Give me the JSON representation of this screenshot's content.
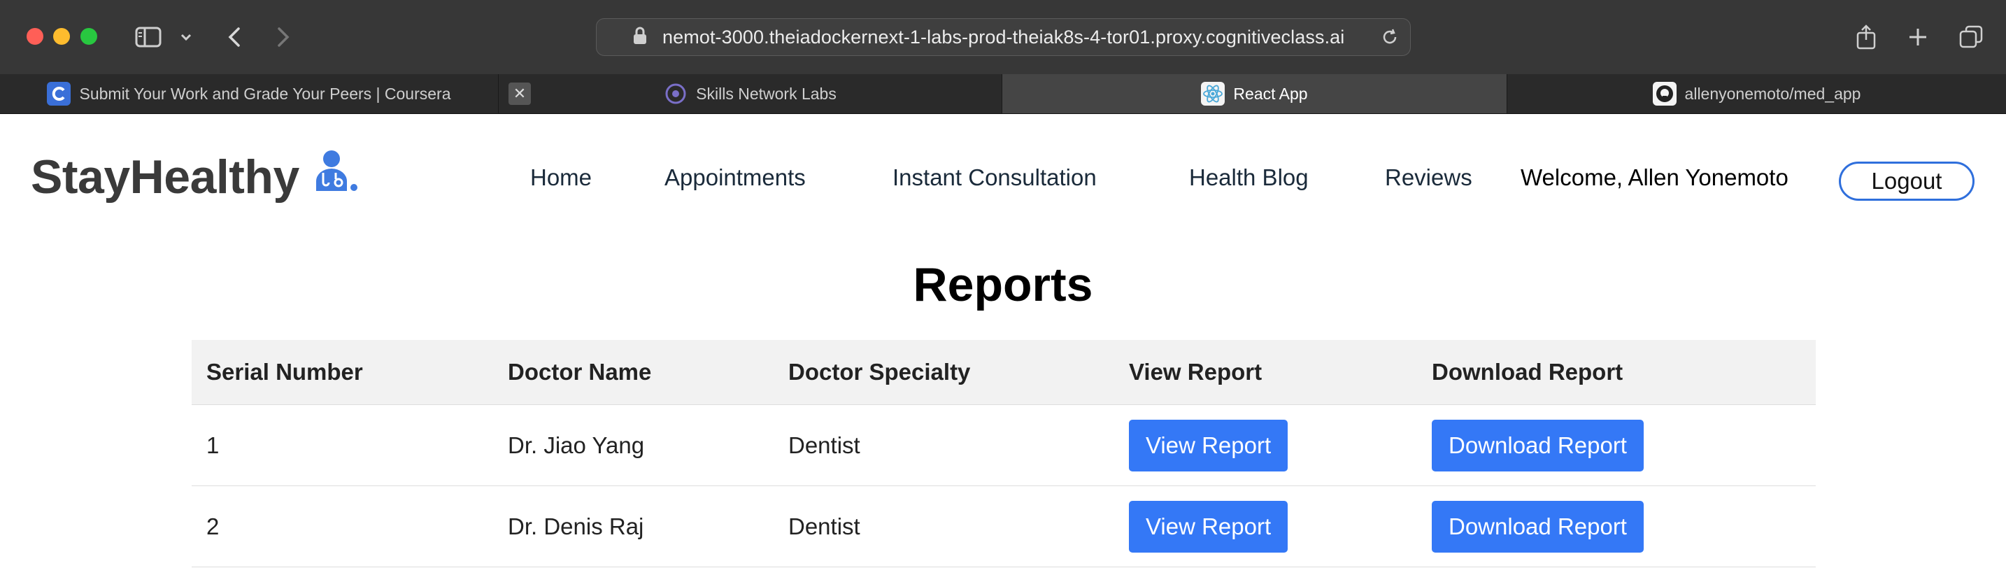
{
  "browser": {
    "url": "nemot-3000.theiadockernext-1-labs-prod-theiak8s-4-tor01.proxy.cognitiveclass.ai",
    "tabs": [
      {
        "label": "Submit Your Work and Grade Your Peers | Coursera",
        "icon": "coursera-icon",
        "active": false
      },
      {
        "label": "Skills Network Labs",
        "icon": "skills-network-icon",
        "active": false
      },
      {
        "label": "React App",
        "icon": "react-icon",
        "active": true
      },
      {
        "label": "allenyonemoto/med_app",
        "icon": "github-icon",
        "active": false
      }
    ]
  },
  "header": {
    "logo_text": "StayHealthy",
    "nav": [
      "Home",
      "Appointments",
      "Instant Consultation",
      "Health Blog",
      "Reviews"
    ],
    "welcome": "Welcome, Allen Yonemoto",
    "logout_label": "Logout"
  },
  "main": {
    "title": "Reports",
    "columns": [
      "Serial Number",
      "Doctor Name",
      "Doctor Specialty",
      "View Report",
      "Download Report"
    ],
    "rows": [
      {
        "serial": "1",
        "doctor": "Dr. Jiao Yang",
        "specialty": "Dentist",
        "view_label": "View Report",
        "download_label": "Download Report"
      },
      {
        "serial": "2",
        "doctor": "Dr. Denis Raj",
        "specialty": "Dentist",
        "view_label": "View Report",
        "download_label": "Download Report"
      }
    ]
  },
  "colors": {
    "accent": "#3478f6",
    "logo_mark": "#3f7be0",
    "titlebar": "#373737"
  }
}
